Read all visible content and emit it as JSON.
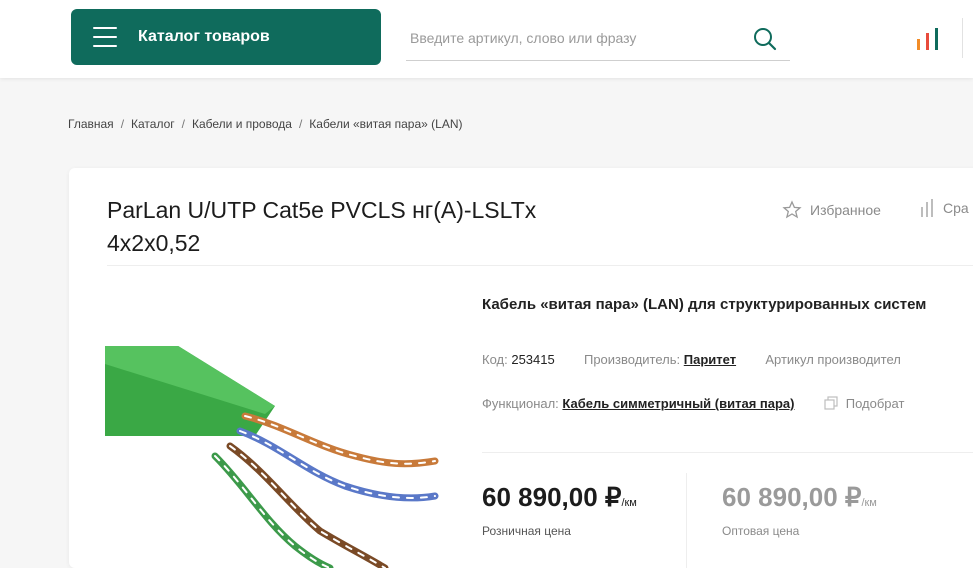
{
  "header": {
    "catalog_label": "Каталог товаров",
    "search_placeholder": "Введите артикул, слово или фразу",
    "accent_color": "#0f6b5c"
  },
  "breadcrumb": [
    "Главная",
    "Каталог",
    "Кабели и провода",
    "Кабели «витая пара» (LAN)"
  ],
  "breadcrumb_separator": "/",
  "product": {
    "title": "ParLan U/UTP Cat5e PVCLS нг(А)-LSLTx 4x2x0,52",
    "favorite_label": "Избранное",
    "compare_label": "Сра",
    "subtitle": "Кабель «витая пара» (LAN) для структурированных систем",
    "code_label": "Код:",
    "code_value": "253415",
    "manufacturer_label": "Производитель:",
    "manufacturer_value": "Паритет",
    "article_label": "Артикул производител",
    "functional_label": "Функционал:",
    "functional_value": "Кабель симметричный (витая пара)",
    "pick_label": "Подобрат",
    "price_retail": "60 890,00 ₽",
    "price_retail_unit": "/км",
    "price_retail_label": "Розничная цена",
    "price_other": "60 890,00 ₽",
    "price_other_unit": "/км",
    "price_other_label": "Оптовая цена"
  },
  "icons": {
    "menu": "burger-menu-icon",
    "search": "search-icon",
    "compare": "compare-bars-icon",
    "favorite": "star-outline-icon",
    "copy": "copy-icon"
  }
}
